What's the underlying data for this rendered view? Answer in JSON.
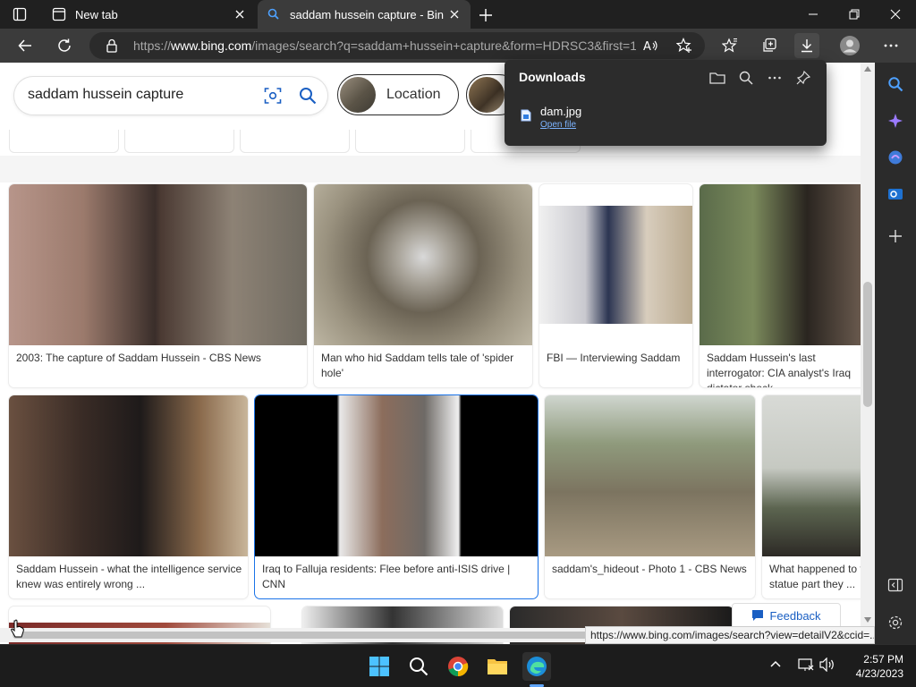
{
  "tabs": [
    {
      "label": "New tab"
    },
    {
      "label": "saddam hussein capture - Bing images"
    }
  ],
  "address": {
    "prefix": "https://",
    "domain": "www.bing.com",
    "path": "/images/search?q=saddam+hussein+capture&form=HDRSC3&first=1"
  },
  "search": {
    "query": "saddam hussein capture",
    "chips": [
      "Location"
    ]
  },
  "results": [
    {
      "caption": "2003: The capture of Saddam Hussein - CBS News"
    },
    {
      "caption": "Man who hid Saddam tells tale of 'spider hole'"
    },
    {
      "caption": "FBI — Interviewing Saddam"
    },
    {
      "caption": "Saddam Hussein's last interrogator: CIA analyst's Iraq dictator shock ..."
    },
    {
      "caption": "Saddam Hussein - what the intelligence service knew was entirely wrong ..."
    },
    {
      "caption": "Iraq to Falluja residents: Flee before anti-ISIS drive | CNN"
    },
    {
      "caption": "saddam's_hideout - Photo 1 - CBS News"
    },
    {
      "caption": "What happened to the statue part they ..."
    }
  ],
  "feedback": {
    "label": "Feedback"
  },
  "downloads": {
    "title": "Downloads",
    "file": "dam.jpg",
    "open": "Open file"
  },
  "status_url": "https://www.bing.com/images/search?view=detailV2&ccid=...",
  "clock": {
    "time": "2:57 PM",
    "date": "4/23/2023"
  }
}
